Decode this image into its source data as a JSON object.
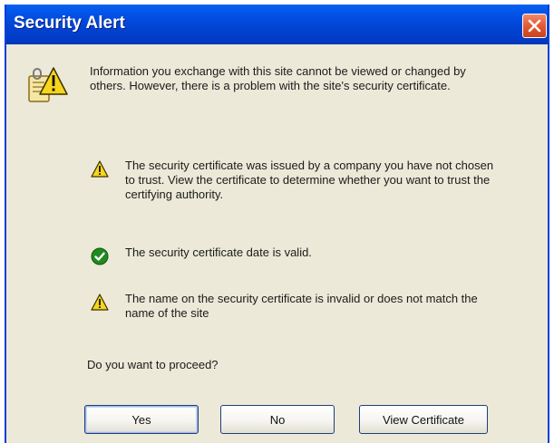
{
  "window": {
    "title": "Security Alert",
    "close_icon": "close-icon"
  },
  "dialog": {
    "icon": "certificate-warning-icon",
    "intro": "Information you exchange with this site cannot be viewed or changed by others. However, there is a problem with the site's security certificate.",
    "items": [
      {
        "icon": "warning-icon",
        "text": "The security certificate was issued by a company you have not chosen to trust. View the certificate to determine whether you want to trust the certifying authority."
      },
      {
        "icon": "check-icon",
        "text": "The security certificate date is valid."
      },
      {
        "icon": "warning-icon",
        "text": "The name on the security certificate is invalid or does not match the name of the site"
      }
    ],
    "question": "Do you want to proceed?"
  },
  "buttons": {
    "yes": "Yes",
    "no": "No",
    "view_certificate": "View Certificate"
  },
  "colors": {
    "titlebar": "#0244d4",
    "dialog_bg": "#ece9d8",
    "close_button": "#e25a32",
    "warning": "#f7d51d",
    "ok": "#1f8a1f"
  }
}
